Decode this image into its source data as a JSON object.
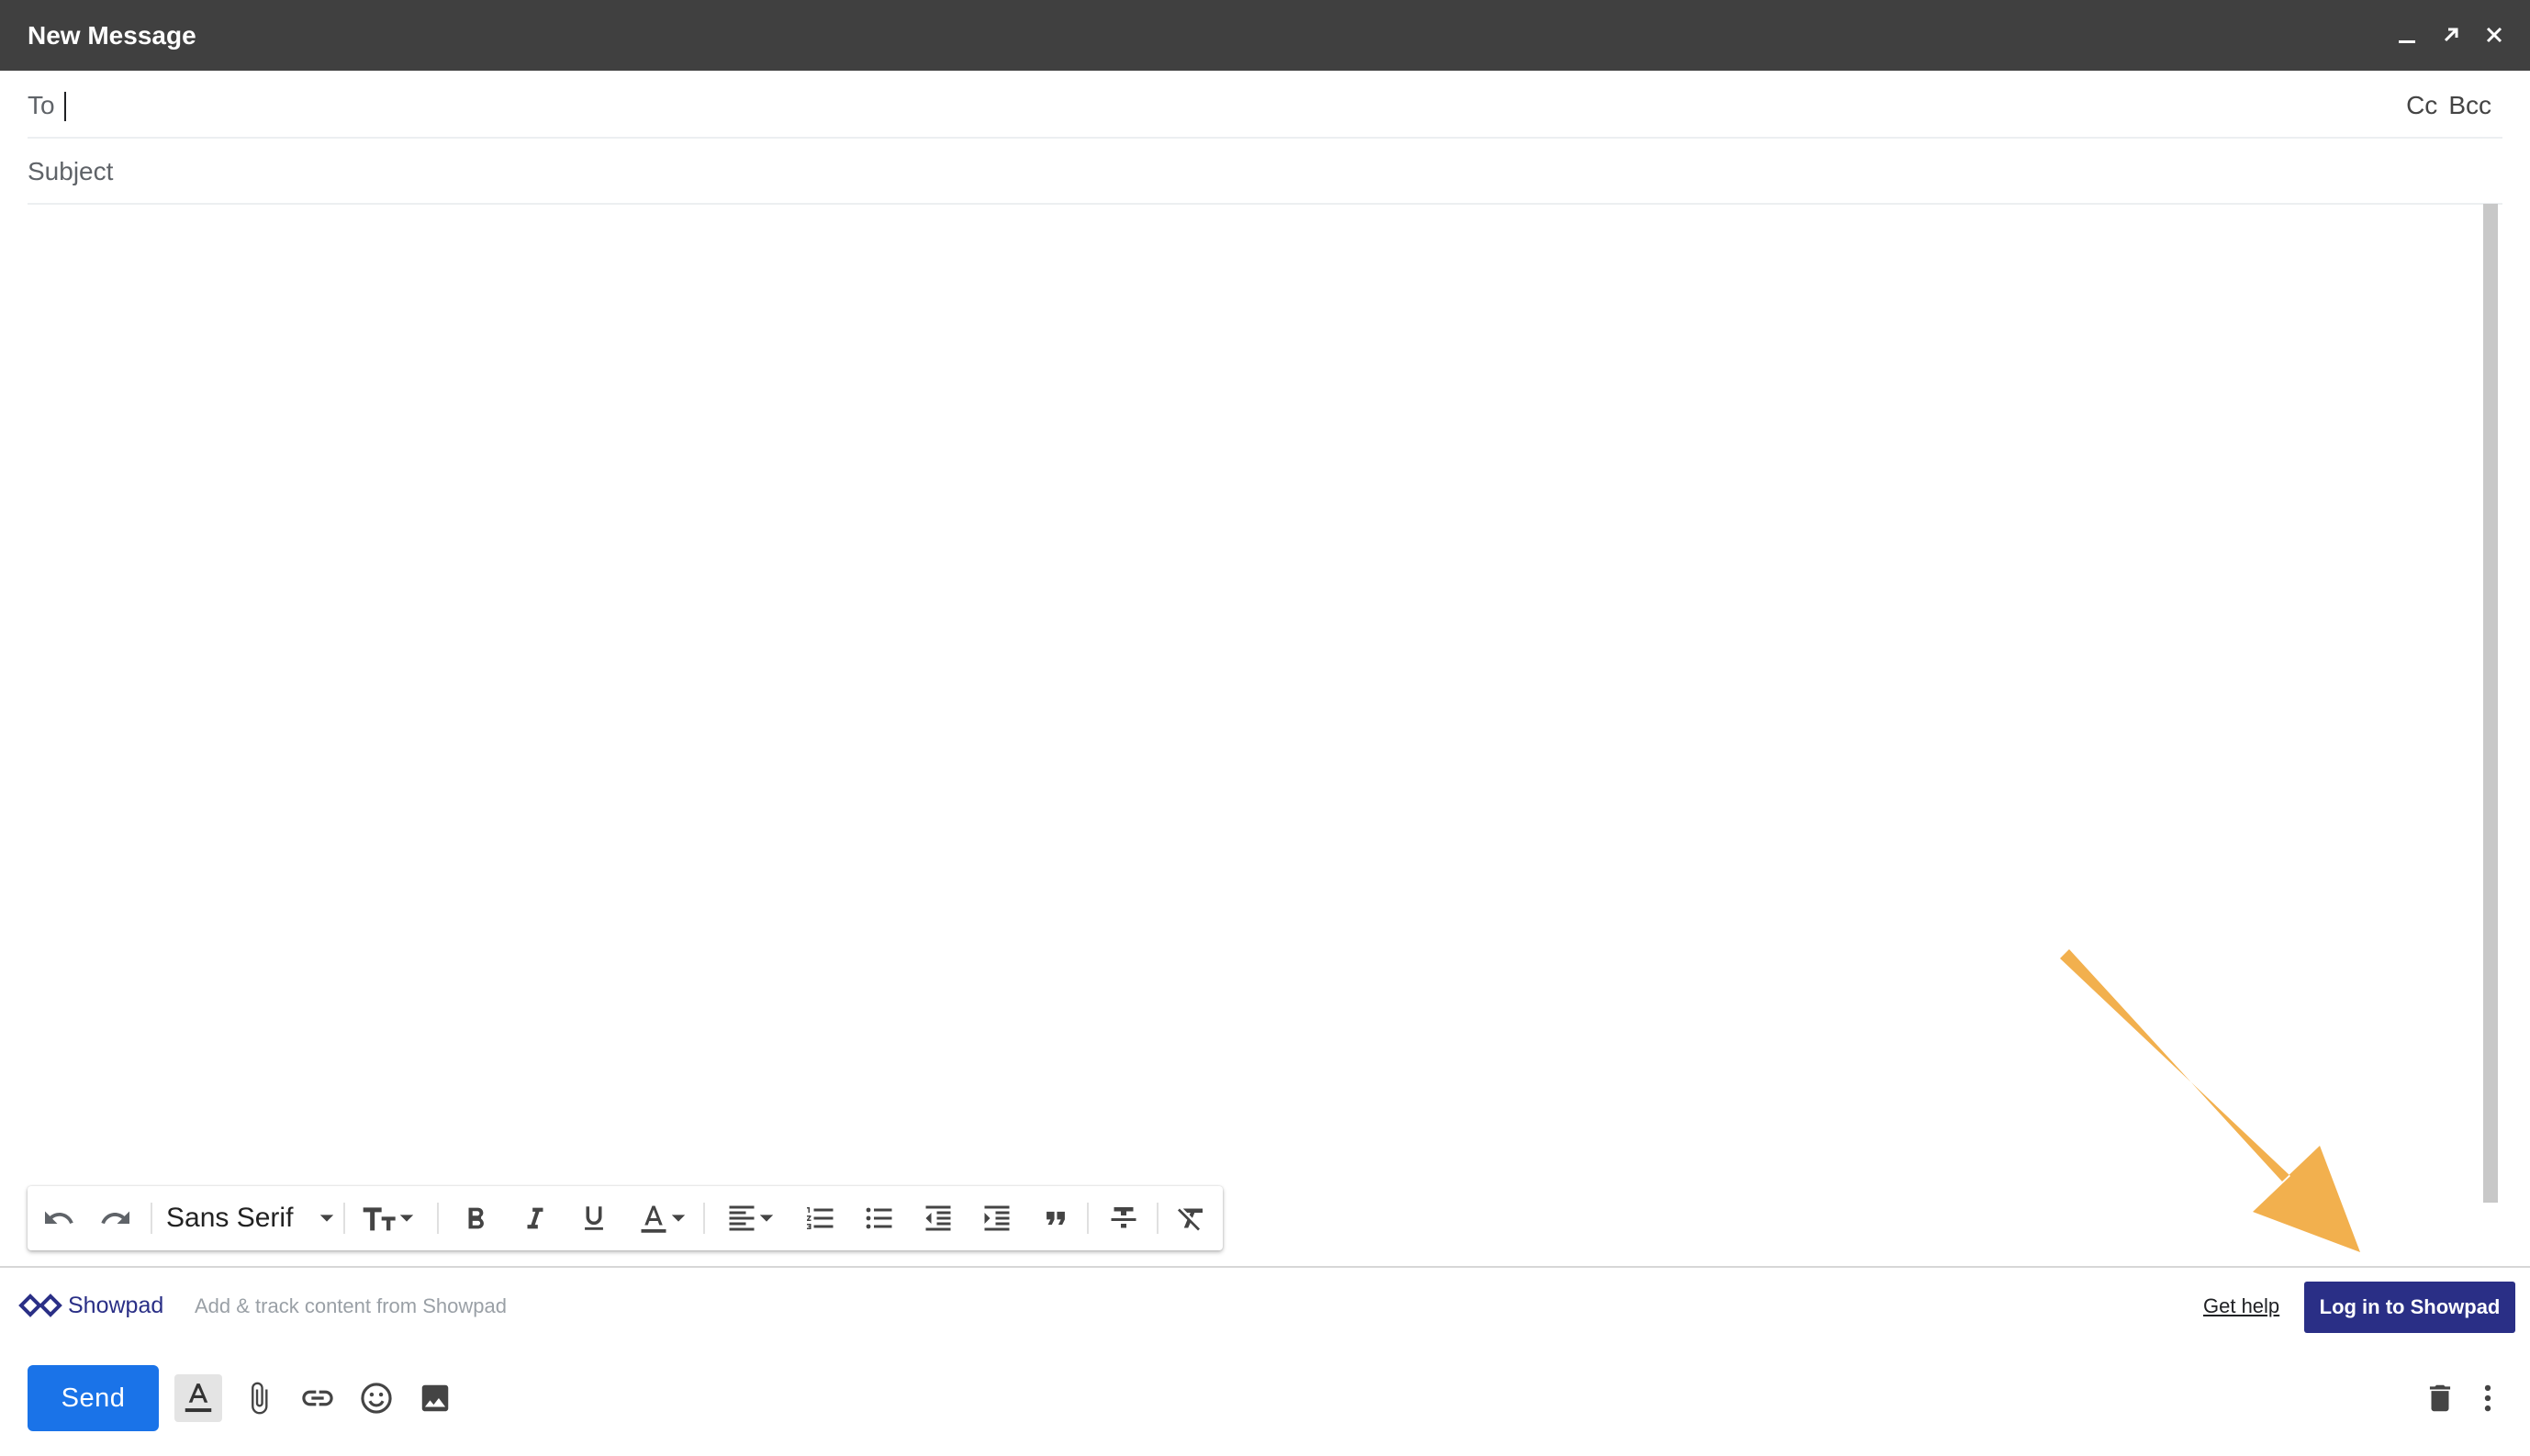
{
  "window": {
    "title": "New Message"
  },
  "fields": {
    "to_label": "To",
    "cc_label": "Cc",
    "bcc_label": "Bcc",
    "subject_placeholder": "Subject"
  },
  "toolbar": {
    "font_name": "Sans Serif",
    "items": [
      "undo-icon",
      "redo-icon",
      "font-family-select",
      "font-size-icon",
      "bold-icon",
      "italic-icon",
      "underline-icon",
      "text-color-icon",
      "align-icon",
      "numbered-list-icon",
      "bulleted-list-icon",
      "indent-less-icon",
      "indent-more-icon",
      "quote-icon",
      "strikethrough-icon",
      "remove-formatting-icon"
    ]
  },
  "showpad": {
    "brand": "Showpad",
    "description": "Add & track content from Showpad",
    "help_link": "Get help",
    "login_button": "Log in to Showpad",
    "brand_color": "#2a2f86"
  },
  "bottom": {
    "send_label": "Send",
    "send_color": "#1a73e8"
  },
  "annotation": {
    "arrow_color": "#f2b04e"
  }
}
